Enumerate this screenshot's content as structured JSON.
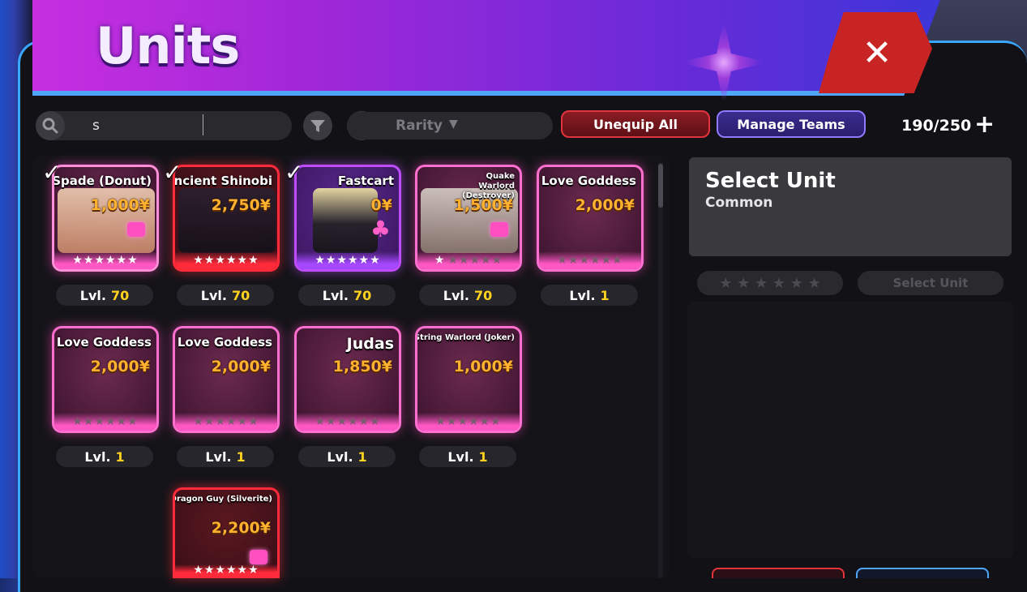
{
  "header": {
    "title": "Units",
    "close_label": "✕"
  },
  "toolbar": {
    "search_value": "s",
    "sort_select": "Rarity",
    "unequip_label": "Unequip All",
    "manage_label": "Manage Teams",
    "capacity": "190/250",
    "add_label": "+"
  },
  "units": [
    {
      "name": "Spade (Donut)",
      "price": "1,000¥",
      "level_label": "Lvl.",
      "level": "70",
      "equipped": true,
      "stars": 6
    },
    {
      "name": "Ancient Shinobi",
      "price": "2,750¥",
      "level_label": "Lvl.",
      "level": "70",
      "equipped": true,
      "stars": 6
    },
    {
      "name": "Fastcart",
      "price": "0¥",
      "level_label": "Lvl.",
      "level": "70",
      "equipped": true,
      "stars": 6
    },
    {
      "name": "Quake Warlord (Destroyer)",
      "price": "1,500¥",
      "level_label": "Lvl.",
      "level": "70",
      "equipped": false,
      "stars": 1
    },
    {
      "name": "Love Goddess",
      "price": "2,000¥",
      "level_label": "Lvl.",
      "level": "1",
      "equipped": false,
      "stars": 0
    },
    {
      "name": "Love Goddess",
      "price": "2,000¥",
      "level_label": "Lvl.",
      "level": "1",
      "equipped": false,
      "stars": 0
    },
    {
      "name": "Love Goddess",
      "price": "2,000¥",
      "level_label": "Lvl.",
      "level": "1",
      "equipped": false,
      "stars": 0
    },
    {
      "name": "Judas",
      "price": "1,850¥",
      "level_label": "Lvl.",
      "level": "1",
      "equipped": false,
      "stars": 0
    },
    {
      "name": "String Warlord (Joker)",
      "price": "1,000¥",
      "level_label": "Lvl.",
      "level": "1",
      "equipped": false,
      "stars": 0
    },
    {
      "name": "Dragon Guy (Silverite)",
      "price": "2,200¥",
      "equipped": false,
      "stars": 6
    }
  ],
  "detail": {
    "title": "Select Unit",
    "rarity": "Common",
    "select_label": "Select Unit"
  },
  "colors": {
    "accent_blue": "#4ea6ff",
    "header_purple": "#a228d8",
    "price_gold": "#ffb02e",
    "level_yellow": "#ffd21e",
    "close_red": "#c82424"
  }
}
